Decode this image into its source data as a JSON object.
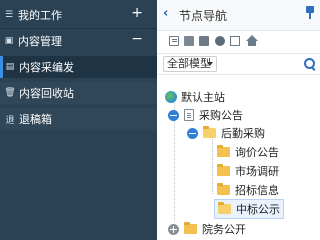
{
  "sidebar": {
    "section1": {
      "label": "我的工作",
      "toggle": "+"
    },
    "section2": {
      "label": "内容管理",
      "toggle": "−"
    },
    "items": [
      {
        "label": "内容采编发",
        "active": true
      },
      {
        "label": "内容回收站",
        "active": false
      },
      {
        "label": "退稿箱",
        "active": false
      }
    ]
  },
  "panel": {
    "title": "节点导航",
    "model_select": {
      "value": "全部模型"
    },
    "toolbar_icons": [
      "copy-icon",
      "doc-icon",
      "archive-icon",
      "globe-icon",
      "clipboard-icon",
      "home-icon"
    ]
  },
  "tree": {
    "root": "默认主站",
    "n1": "采购公告",
    "n1a": "后勤采购",
    "n1a1": "询价公告",
    "n1a2": "市场调研",
    "n1a3": "招标信息",
    "n1a4": "中标公示",
    "n2": "院务公开"
  },
  "colors": {
    "sidebar_bg": "#2b4254",
    "accent": "#2f7fd6",
    "folder": "#f2c14f"
  }
}
